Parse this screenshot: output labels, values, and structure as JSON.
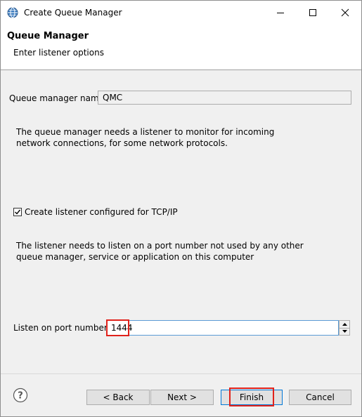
{
  "window": {
    "title": "Create Queue Manager"
  },
  "header": {
    "title": "Queue Manager",
    "subtitle": "Enter listener options"
  },
  "form": {
    "qm_name_label": "Queue manager name:",
    "qm_name_value": "QMC",
    "listener_info": "The queue manager needs a listener to monitor for incoming network connections, for some network protocols.",
    "tcp_checkbox_label": "Create listener configured for TCP/IP",
    "tcp_checkbox_checked": true,
    "port_info": "The listener needs to listen on a port number not used by any other queue manager, service or application on this computer",
    "port_label": "Listen on port number:",
    "port_value": "1444"
  },
  "footer": {
    "back_label": "< Back",
    "next_label": "Next >",
    "finish_label": "Finish",
    "cancel_label": "Cancel"
  },
  "icons": {
    "app": "globe-icon",
    "help": "help-icon",
    "minimize": "minimize-icon",
    "maximize": "maximize-icon",
    "close": "close-icon",
    "check": "checkmark-icon",
    "spin_up": "spin-up-icon",
    "spin_down": "spin-down-icon"
  },
  "colors": {
    "highlight": "#e0221b",
    "focus_border": "#5b9bd5",
    "default_button_border": "#0078d7"
  }
}
